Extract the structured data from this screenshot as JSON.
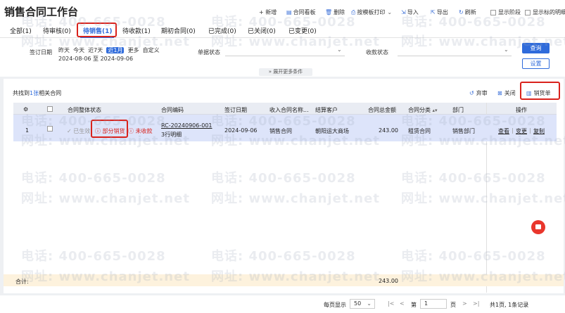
{
  "app": {
    "title": "销售合同工作台"
  },
  "toolbar": {
    "new": "+ 新增",
    "board": "合同看板",
    "delete": "删除",
    "print": "按模板打印",
    "import": "导入",
    "export": "导出",
    "refresh": "刷新",
    "show_stage": "显示阶段",
    "show_target": "显示标的明细"
  },
  "tabs": [
    {
      "label": "全部(1)"
    },
    {
      "label": "待审核(0)"
    },
    {
      "label": "待销售(1)"
    },
    {
      "label": "待收款(1)"
    },
    {
      "label": "期初合同(0)"
    },
    {
      "label": "已完成(0)"
    },
    {
      "label": "已关闭(0)"
    },
    {
      "label": "已变更(0)"
    }
  ],
  "filters": {
    "sign_date_label": "签订日期",
    "quick": [
      "昨天",
      "今天",
      "近7天",
      "近1月",
      "更多",
      "自定义"
    ],
    "date_range": "2024-08-06 至 2024-09-06",
    "doc_status_label": "单据状态",
    "pay_status_label": "收款状态",
    "query": "查询",
    "reset": "设置",
    "expand": "展开更多条件"
  },
  "list": {
    "found_prefix": "共找到",
    "found_count": "1张",
    "found_suffix": "相关合同",
    "actions": {
      "discard": "弃审",
      "close": "关闭",
      "delivery": "销货单"
    }
  },
  "table": {
    "headers": {
      "status": "合同整体状态",
      "code": "合同编码",
      "sign_date": "签订日期",
      "income": "收入合同名称...",
      "customer": "结算客户",
      "amount": "合同总金额",
      "category": "合同分类",
      "dept": "部门",
      "ops": "操作"
    },
    "rows": [
      {
        "idx": "1",
        "status_effective": "已生效",
        "status_partial": "部分销货",
        "status_unpaid": "未收款",
        "code_line1": "RC-20240906-001",
        "code_line2": "3行明细",
        "sign_date": "2024-09-06",
        "income": "销售合同",
        "customer": "朝阳运大商场",
        "amount": "243.00",
        "category": "租赁合同",
        "dept": "销售部门",
        "op_view": "查看",
        "op_change": "变更",
        "op_copy": "复制"
      }
    ],
    "summary_label": "合计:",
    "summary_amount": "243.00"
  },
  "pager": {
    "per_page_label": "每页显示",
    "per_page": "50",
    "page_prefix": "第",
    "page": "1",
    "page_suffix": "页",
    "info": "共1页, 1条记录"
  },
  "watermark": {
    "phone": "电话: 400-665-0028",
    "site": "网址: www.chanjet.net"
  },
  "colors": {
    "accent": "#2f6bdb",
    "highlight": "#d9221c",
    "row_selected": "#dde4fa",
    "summary_bg": "#fdf2dd"
  }
}
